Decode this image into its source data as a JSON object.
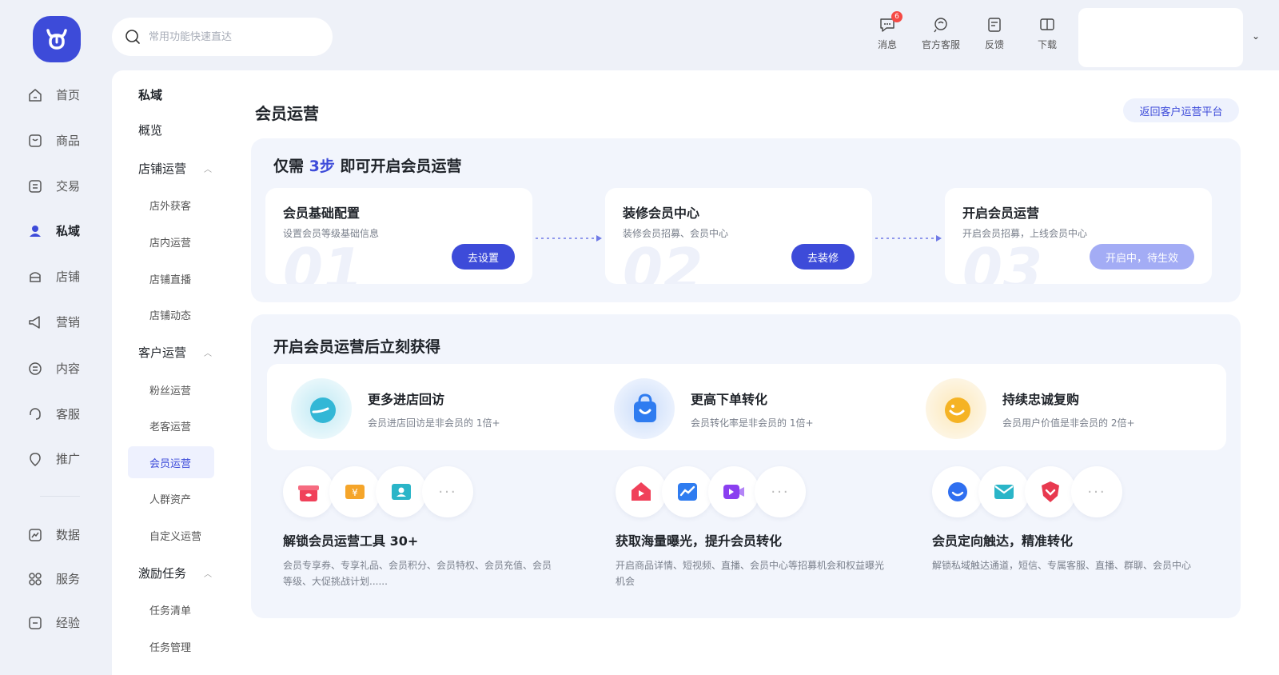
{
  "search": {
    "placeholder": "常用功能快速直达"
  },
  "top_actions": [
    {
      "label": "消息",
      "badge": "6",
      "icon": "message-icon"
    },
    {
      "label": "官方客服",
      "icon": "support-icon"
    },
    {
      "label": "反馈",
      "icon": "feedback-icon"
    },
    {
      "label": "下载",
      "icon": "download-icon"
    }
  ],
  "left_nav": [
    {
      "label": "首页",
      "icon": "home-icon"
    },
    {
      "label": "商品",
      "icon": "product-icon"
    },
    {
      "label": "交易",
      "icon": "trade-icon"
    },
    {
      "label": "私域",
      "icon": "private-domain-icon",
      "active": true
    },
    {
      "label": "店铺",
      "icon": "store-icon"
    },
    {
      "label": "营销",
      "icon": "marketing-icon"
    },
    {
      "label": "内容",
      "icon": "content-icon"
    },
    {
      "label": "客服",
      "icon": "customer-service-icon"
    },
    {
      "label": "推广",
      "icon": "promotion-icon"
    },
    {
      "label": "数据",
      "icon": "data-icon"
    },
    {
      "label": "服务",
      "icon": "service-icon"
    },
    {
      "label": "经验",
      "icon": "experience-icon"
    }
  ],
  "sub_nav": {
    "title": "私域",
    "overview": "概览",
    "group1": "店铺运营",
    "group1_items": [
      "店外获客",
      "店内运营",
      "店铺直播",
      "店铺动态"
    ],
    "group2": "客户运营",
    "group2_items": [
      "粉丝运营",
      "老客运营",
      "会员运营",
      "人群资产",
      "自定义运营"
    ],
    "group3": "激励任务",
    "group3_items": [
      "任务清单",
      "任务管理"
    ]
  },
  "page": {
    "title": "会员运营",
    "back_button": "返回客户运营平台"
  },
  "steps_header": {
    "prefix": "仅需",
    "highlight": "3步",
    "suffix": "即可开启会员运营"
  },
  "steps": [
    {
      "title": "会员基础配置",
      "desc": "设置会员等级基础信息",
      "num": "01",
      "button": "去设置",
      "disabled": false
    },
    {
      "title": "装修会员中心",
      "desc": "装修会员招募、会员中心",
      "num": "02",
      "button": "去装修",
      "disabled": false
    },
    {
      "title": "开启会员运营",
      "desc": "开启会员招募，上线会员中心",
      "num": "03",
      "button": "开启中，待生效",
      "disabled": true
    }
  ],
  "benefits_title": "开启会员运营后立刻获得",
  "benefits": [
    {
      "title": "更多进店回访",
      "desc": "会员进店回访是非会员的 1倍+",
      "icon": "shoe-icon",
      "color": "#33b7d6"
    },
    {
      "title": "更高下单转化",
      "desc": "会员转化率是非会员的 1倍+",
      "icon": "shopping-bag-icon",
      "color": "#2f7cf0"
    },
    {
      "title": "持续忠诚复购",
      "desc": "会员用户价值是非会员的 2倍+",
      "icon": "smile-icon",
      "color": "#f5b324"
    }
  ],
  "features": [
    {
      "title": "解锁会员运营工具 30+",
      "desc": "会员专享券、专享礼品、会员积分、会员特权、会员充值、会员等级、大促挑战计划......",
      "icons": [
        "gift-icon",
        "coupon-icon",
        "member-card-icon"
      ],
      "more": "···"
    },
    {
      "title": "获取海量曝光，提升会员转化",
      "desc": "开启商品详情、短视频、直播、会员中心等招募机会和权益曝光机会",
      "icons": [
        "home-video-icon",
        "trend-chart-icon",
        "video-camera-icon"
      ],
      "more": "···"
    },
    {
      "title": "会员定向触达，精准转化",
      "desc": "解锁私域触达通道，短信、专属客服、直播、群聊、会员中心",
      "icons": [
        "chat-bubble-icon",
        "mail-icon",
        "heart-shield-icon"
      ],
      "more": "···"
    }
  ],
  "colors": {
    "accent": "#3d4bd9",
    "disabled_button": "#a3acf5",
    "badge": "#f54a45"
  }
}
